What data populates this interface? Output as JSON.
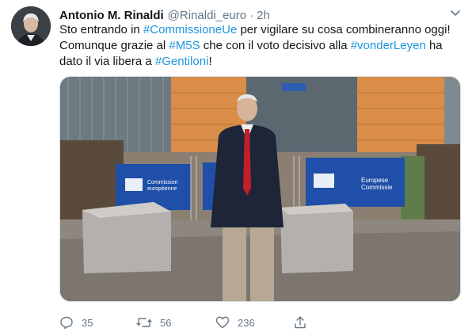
{
  "author": {
    "name": "Antonio M. Rinaldi",
    "handle": "@Rinaldi_euro",
    "separator": "·",
    "time": "2h"
  },
  "tweet": {
    "segments": [
      {
        "text": "Sto entrando in ",
        "tag": false
      },
      {
        "text": "#CommissioneUe",
        "tag": true
      },
      {
        "text": " per vigilare su cosa combineranno oggi! Comunque grazie al ",
        "tag": false
      },
      {
        "text": "#M5S",
        "tag": true
      },
      {
        "text": " che con il voto decisivo alla ",
        "tag": false
      },
      {
        "text": "#vonderLeyen",
        "tag": true
      },
      {
        "text": " ha dato il via libera a ",
        "tag": false
      },
      {
        "text": "#Gentiloni",
        "tag": true
      },
      {
        "text": "!",
        "tag": false
      }
    ]
  },
  "media": {
    "banner_left_line1": "Commission",
    "banner_left_line2": "européenne",
    "banner_right_line1": "Europese",
    "banner_right_line2": "Commissie"
  },
  "actions": {
    "reply_count": "35",
    "retweet_count": "56",
    "like_count": "236"
  },
  "icons": {
    "reply": "reply-icon",
    "retweet": "retweet-icon",
    "like": "like-icon",
    "share": "share-icon",
    "more": "chevron-down-icon"
  },
  "colors": {
    "link": "#1b95e0",
    "secondary": "#657786",
    "eu_blue": "#1f4fa8"
  }
}
